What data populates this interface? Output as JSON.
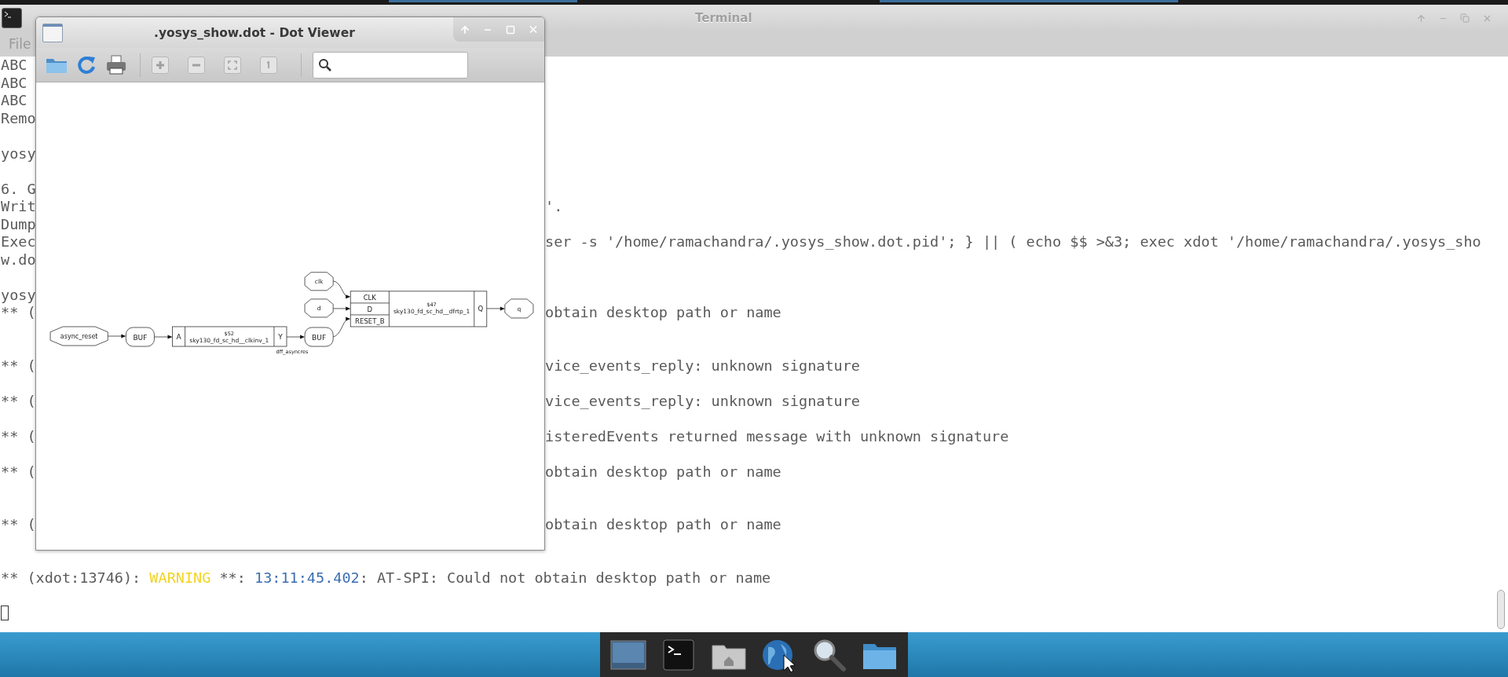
{
  "terminal": {
    "title": "Terminal",
    "menu": [
      "File"
    ],
    "lines": [
      {
        "kind": "split",
        "left": "ABC"
      },
      {
        "kind": "split",
        "left": "ABC"
      },
      {
        "kind": "split",
        "left": "ABC"
      },
      {
        "kind": "split",
        "left": "Remo"
      },
      {
        "kind": "blank"
      },
      {
        "kind": "split",
        "left": "yosy"
      },
      {
        "kind": "blank"
      },
      {
        "kind": "split",
        "left": "6. G"
      },
      {
        "kind": "split",
        "left": "Writ",
        "right": "'."
      },
      {
        "kind": "split",
        "left": "Dump"
      },
      {
        "kind": "split",
        "left": "Exec",
        "right": "ser -s '/home/ramachandra/.yosys_show.dot.pid'; } || ( echo $$ >&3; exec xdot '/home/ramachandra/.yosys_sho"
      },
      {
        "kind": "split",
        "left": "w.do"
      },
      {
        "kind": "blank"
      },
      {
        "kind": "split",
        "left": "yosy"
      },
      {
        "kind": "split",
        "left": "** (",
        "right": "obtain desktop path or name"
      },
      {
        "kind": "blank"
      },
      {
        "kind": "blank"
      },
      {
        "kind": "split",
        "left": "** (",
        "right": "vice_events_reply: unknown signature"
      },
      {
        "kind": "blank"
      },
      {
        "kind": "split",
        "left": "** (",
        "right": "vice_events_reply: unknown signature"
      },
      {
        "kind": "blank"
      },
      {
        "kind": "split",
        "left": "** (",
        "right": "isteredEvents returned message with unknown signature"
      },
      {
        "kind": "blank"
      },
      {
        "kind": "split",
        "left": "** (",
        "right": "obtain desktop path or name"
      },
      {
        "kind": "blank"
      },
      {
        "kind": "blank"
      },
      {
        "kind": "split",
        "left": "** (",
        "right": "obtain desktop path or name"
      },
      {
        "kind": "blank"
      },
      {
        "kind": "blank"
      },
      {
        "kind": "full",
        "segments": [
          {
            "text": "** (xdot:13746): ",
            "color": "#5a5a5a"
          },
          {
            "text": "WARNING",
            "color": "#f2d422"
          },
          {
            "text": " **: ",
            "color": "#5a5a5a"
          },
          {
            "text": "13:11:45.402",
            "color": "#3b6eb0"
          },
          {
            "text": ": AT-SPI: Could not obtain desktop path or name",
            "color": "#5a5a5a"
          }
        ]
      },
      {
        "kind": "blank"
      },
      {
        "kind": "cursor"
      }
    ]
  },
  "dot_viewer": {
    "title": ".yosys_show.dot - Dot Viewer",
    "graph": {
      "ports": [
        "async_reset",
        "clk",
        "d",
        "q"
      ],
      "buffers": [
        "BUF",
        "BUF"
      ],
      "cells": [
        {
          "id": "$52",
          "type": "sky130_fd_sc_hd__clkinv_1",
          "inputs": [
            "A"
          ],
          "outputs": [
            "Y"
          ]
        },
        {
          "id": "$47",
          "type": "sky130_fd_sc_hd__dfrtp_1",
          "inputs": [
            "CLK",
            "D",
            "RESET_B"
          ],
          "outputs": [
            "Q"
          ]
        }
      ],
      "net_labels": [
        "dff_asyncres"
      ]
    }
  }
}
